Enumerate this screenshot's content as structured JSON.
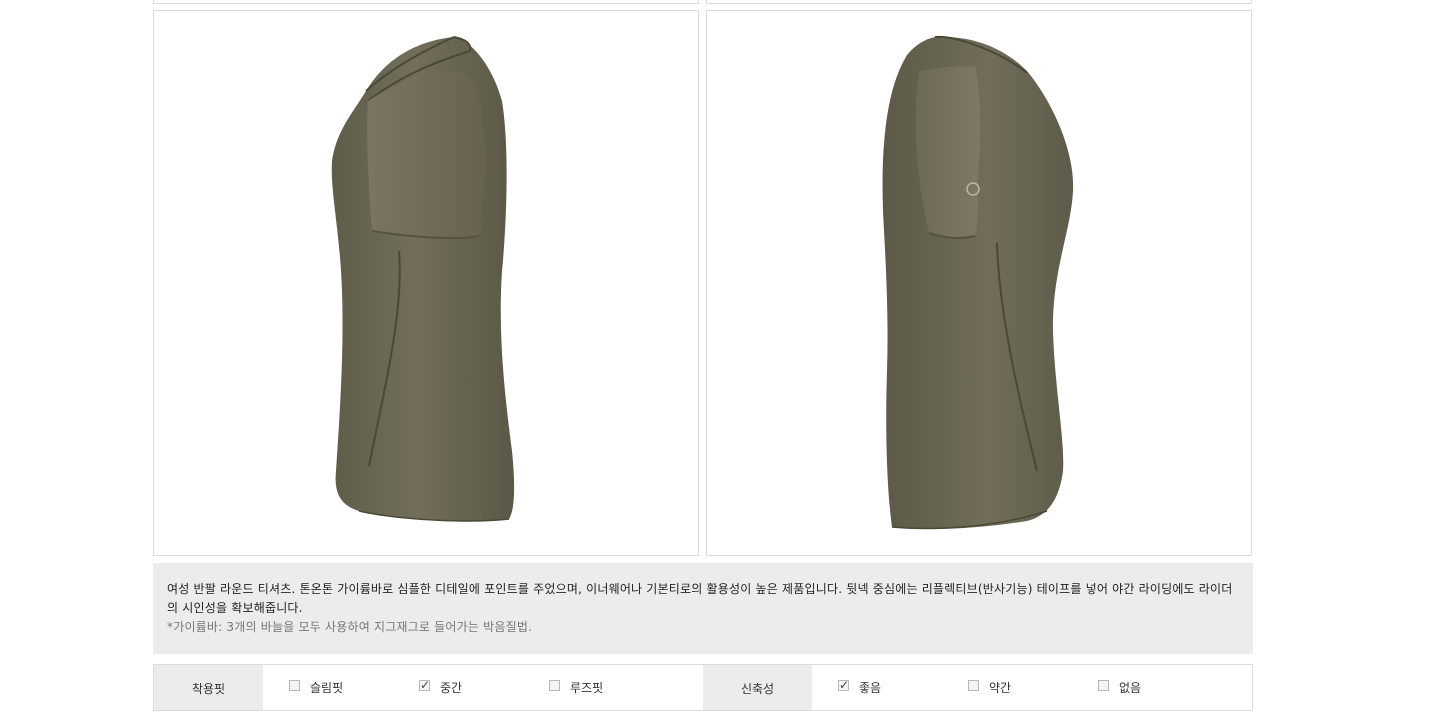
{
  "description": {
    "main": "여성 반팔 라운드 티셔츠. 톤온톤 가이륨바로 심플한 디테일에 포인트를 주었으며, 이너웨어나 기본티로의 활용성이 높은 제품입니다. 뒷넥 중심에는 리플렉티브(반사기능) 테이프를 넣어 야간 라이딩에도 라이더의 시인성을 확보해줍니다.",
    "note": "*가이륨바: 3개의 바늘을 모두 사용하여 지그재그로 들어가는 박음질법."
  },
  "colors": {
    "shirt": "#6f6b58",
    "shirt_dark": "#5c5948",
    "seam": "#4b4836",
    "panel_bg": "#ececec"
  },
  "spec": {
    "fit": {
      "label": "착용핏",
      "options": [
        {
          "label": "슬림핏",
          "checked": false
        },
        {
          "label": "중간",
          "checked": true
        },
        {
          "label": "루즈핏",
          "checked": false
        }
      ]
    },
    "stretch": {
      "label": "신축성",
      "options": [
        {
          "label": "좋음",
          "checked": true
        },
        {
          "label": "약간",
          "checked": false
        },
        {
          "label": "없음",
          "checked": false
        }
      ]
    }
  }
}
